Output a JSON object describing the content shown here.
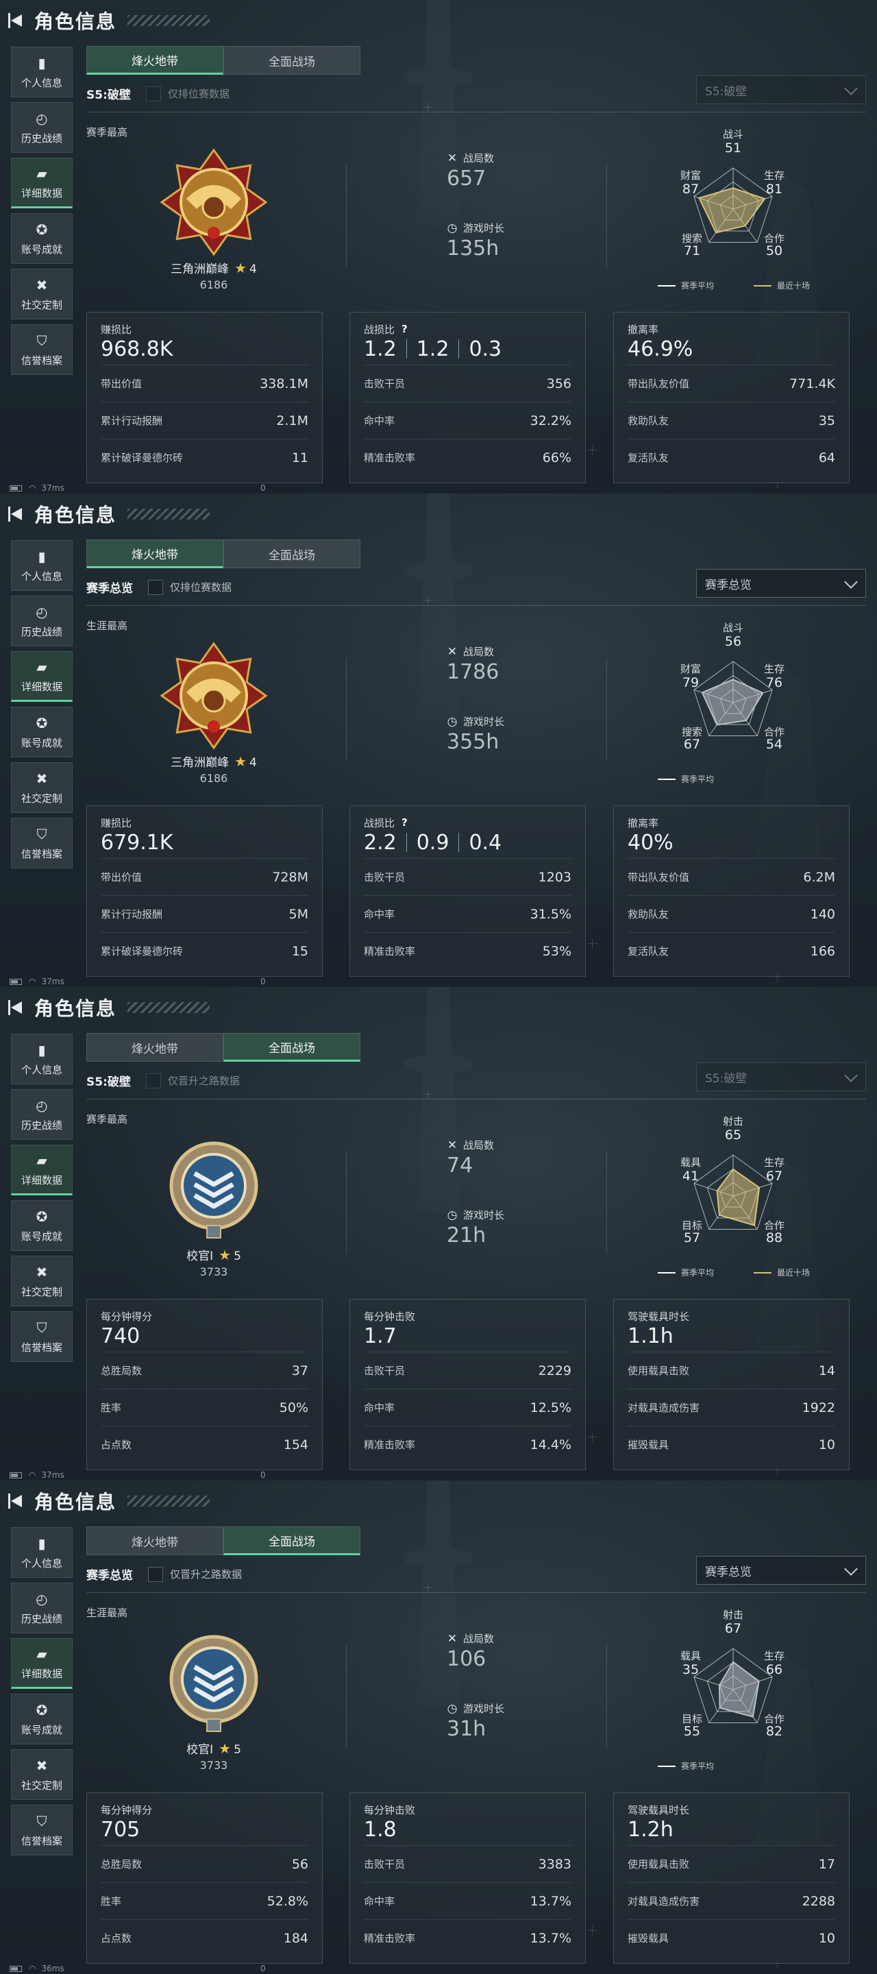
{
  "colors": {
    "accent_green": "#5fd3a0",
    "star_gold": "#e8c14d",
    "radar_gold": "#d8c27a",
    "radar_fill_gray": "#b9c0c3"
  },
  "screens": [
    {
      "header": {
        "title": "角色信息"
      },
      "sidebar": {
        "items": [
          {
            "label": "个人信息",
            "icon": "bar-chart-icon"
          },
          {
            "label": "历史战绩",
            "icon": "history-icon"
          },
          {
            "label": "详细数据",
            "icon": "folder-icon",
            "active": true
          },
          {
            "label": "账号成就",
            "icon": "achievement-icon"
          },
          {
            "label": "社交定制",
            "icon": "tools-icon"
          },
          {
            "label": "信誉档案",
            "icon": "shield-icon"
          }
        ]
      },
      "tabs": [
        {
          "label": "烽火地带",
          "active": true
        },
        {
          "label": "全面战场",
          "active": false
        }
      ],
      "filter": {
        "season": "S5:破壁",
        "checkbox_label": "仅排位赛数据",
        "dim": true
      },
      "dropdown": {
        "value": "S5:破壁",
        "dim": true
      },
      "best_label": "赛季最高",
      "rank": {
        "name": "三角洲巅峰",
        "stars": "4",
        "score": "6186",
        "badge": "gold-eagle-badge"
      },
      "matches": {
        "label": "战局数",
        "value": "657"
      },
      "playtime": {
        "label": "游戏时长",
        "value": "135h"
      },
      "radar": {
        "labels": [
          "战斗",
          "生存",
          "合作",
          "搜索",
          "财富"
        ],
        "values": [
          "51",
          "81",
          "50",
          "71",
          "87"
        ],
        "levels": [
          0.51,
          0.81,
          0.5,
          0.71,
          0.87
        ],
        "fill_color": "#d8c27a"
      },
      "legend": [
        {
          "label": "赛季平均",
          "color": "#ffffff"
        },
        {
          "label": "最近十场",
          "color": "#d8c27a"
        }
      ],
      "cards": [
        {
          "title": "赚损比",
          "main": [
            "968.8K"
          ],
          "help": false,
          "rows": [
            {
              "label": "带出价值",
              "value": "338.1M"
            },
            {
              "label": "累计行动报酬",
              "value": "2.1M"
            },
            {
              "label": "累计破译曼德尔砖",
              "value": "11"
            }
          ]
        },
        {
          "title": "战损比",
          "main": [
            "1.2",
            "1.2",
            "0.3"
          ],
          "help": true,
          "rows": [
            {
              "label": "击败干员",
              "value": "356"
            },
            {
              "label": "命中率",
              "value": "32.2%"
            },
            {
              "label": "精准击败率",
              "value": "66%"
            }
          ]
        },
        {
          "title": "撤离率",
          "main": [
            "46.9%"
          ],
          "help": false,
          "rows": [
            {
              "label": "带出队友价值",
              "value": "771.4K"
            },
            {
              "label": "救助队友",
              "value": "35"
            },
            {
              "label": "复活队友",
              "value": "64"
            }
          ]
        }
      ],
      "status": {
        "ping": "37ms",
        "zero": "0"
      }
    },
    {
      "header": {
        "title": "角色信息"
      },
      "sidebar": {
        "items": [
          {
            "label": "个人信息",
            "icon": "bar-chart-icon"
          },
          {
            "label": "历史战绩",
            "icon": "history-icon"
          },
          {
            "label": "详细数据",
            "icon": "folder-icon",
            "active": true
          },
          {
            "label": "账号成就",
            "icon": "achievement-icon"
          },
          {
            "label": "社交定制",
            "icon": "tools-icon"
          },
          {
            "label": "信誉档案",
            "icon": "shield-icon"
          }
        ]
      },
      "tabs": [
        {
          "label": "烽火地带",
          "active": true
        },
        {
          "label": "全面战场",
          "active": false
        }
      ],
      "filter": {
        "season": "赛季总览",
        "checkbox_label": "仅排位赛数据",
        "dim": false
      },
      "dropdown": {
        "value": "赛季总览",
        "dim": false
      },
      "best_label": "生涯最高",
      "rank": {
        "name": "三角洲巅峰",
        "stars": "4",
        "score": "6186",
        "badge": "gold-eagle-badge"
      },
      "matches": {
        "label": "战局数",
        "value": "1786"
      },
      "playtime": {
        "label": "游戏时长",
        "value": "355h"
      },
      "radar": {
        "labels": [
          "战斗",
          "生存",
          "合作",
          "搜索",
          "财富"
        ],
        "values": [
          "56",
          "76",
          "54",
          "67",
          "79"
        ],
        "levels": [
          0.56,
          0.76,
          0.54,
          0.67,
          0.79
        ],
        "fill_color": "#b9c0c3"
      },
      "legend": [
        {
          "label": "赛季平均",
          "color": "#ffffff"
        }
      ],
      "cards": [
        {
          "title": "赚损比",
          "main": [
            "679.1K"
          ],
          "help": false,
          "rows": [
            {
              "label": "带出价值",
              "value": "728M"
            },
            {
              "label": "累计行动报酬",
              "value": "5M"
            },
            {
              "label": "累计破译曼德尔砖",
              "value": "15"
            }
          ]
        },
        {
          "title": "战损比",
          "main": [
            "2.2",
            "0.9",
            "0.4"
          ],
          "help": true,
          "rows": [
            {
              "label": "击败干员",
              "value": "1203"
            },
            {
              "label": "命中率",
              "value": "31.5%"
            },
            {
              "label": "精准击败率",
              "value": "53%"
            }
          ]
        },
        {
          "title": "撤离率",
          "main": [
            "40%"
          ],
          "help": false,
          "rows": [
            {
              "label": "带出队友价值",
              "value": "6.2M"
            },
            {
              "label": "救助队友",
              "value": "140"
            },
            {
              "label": "复活队友",
              "value": "166"
            }
          ]
        }
      ],
      "status": {
        "ping": "37ms",
        "zero": "0"
      }
    },
    {
      "header": {
        "title": "角色信息"
      },
      "sidebar": {
        "items": [
          {
            "label": "个人信息",
            "icon": "bar-chart-icon"
          },
          {
            "label": "历史战绩",
            "icon": "history-icon"
          },
          {
            "label": "详细数据",
            "icon": "folder-icon",
            "active": true
          },
          {
            "label": "账号成就",
            "icon": "achievement-icon"
          },
          {
            "label": "社交定制",
            "icon": "tools-icon"
          },
          {
            "label": "信誉档案",
            "icon": "shield-icon"
          }
        ]
      },
      "tabs": [
        {
          "label": "烽火地带",
          "active": false
        },
        {
          "label": "全面战场",
          "active": true
        }
      ],
      "filter": {
        "season": "S5:破壁",
        "checkbox_label": "仅晋升之路数据",
        "dim": true
      },
      "dropdown": {
        "value": "S5:破壁",
        "dim": true
      },
      "best_label": "赛季最高",
      "rank": {
        "name": "校官Ⅰ",
        "stars": "5",
        "score": "3733",
        "badge": "officer-chevron-badge"
      },
      "matches": {
        "label": "战局数",
        "value": "74"
      },
      "playtime": {
        "label": "游戏时长",
        "value": "21h"
      },
      "radar": {
        "labels": [
          "射击",
          "生存",
          "合作",
          "目标",
          "载具"
        ],
        "values": [
          "65",
          "67",
          "88",
          "57",
          "41"
        ],
        "levels": [
          0.65,
          0.67,
          0.88,
          0.57,
          0.41
        ],
        "fill_color": "#d8c27a"
      },
      "legend": [
        {
          "label": "赛季平均",
          "color": "#ffffff"
        },
        {
          "label": "最近十场",
          "color": "#d8c27a"
        }
      ],
      "cards": [
        {
          "title": "每分钟得分",
          "main": [
            "740"
          ],
          "help": false,
          "rows": [
            {
              "label": "总胜局数",
              "value": "37"
            },
            {
              "label": "胜率",
              "value": "50%"
            },
            {
              "label": "占点数",
              "value": "154"
            }
          ]
        },
        {
          "title": "每分钟击败",
          "main": [
            "1.7"
          ],
          "help": false,
          "rows": [
            {
              "label": "击败干员",
              "value": "2229"
            },
            {
              "label": "命中率",
              "value": "12.5%"
            },
            {
              "label": "精准击败率",
              "value": "14.4%"
            }
          ]
        },
        {
          "title": "驾驶载具时长",
          "main": [
            "1.1h"
          ],
          "help": false,
          "rows": [
            {
              "label": "使用载具击败",
              "value": "14"
            },
            {
              "label": "对载具造成伤害",
              "value": "1922"
            },
            {
              "label": "摧毁载具",
              "value": "10"
            }
          ]
        }
      ],
      "status": {
        "ping": "37ms",
        "zero": "0"
      }
    },
    {
      "header": {
        "title": "角色信息"
      },
      "sidebar": {
        "items": [
          {
            "label": "个人信息",
            "icon": "bar-chart-icon"
          },
          {
            "label": "历史战绩",
            "icon": "history-icon"
          },
          {
            "label": "详细数据",
            "icon": "folder-icon",
            "active": true
          },
          {
            "label": "账号成就",
            "icon": "achievement-icon"
          },
          {
            "label": "社交定制",
            "icon": "tools-icon"
          },
          {
            "label": "信誉档案",
            "icon": "shield-icon"
          }
        ]
      },
      "tabs": [
        {
          "label": "烽火地带",
          "active": false
        },
        {
          "label": "全面战场",
          "active": true
        }
      ],
      "filter": {
        "season": "赛季总览",
        "checkbox_label": "仅晋升之路数据",
        "dim": false
      },
      "dropdown": {
        "value": "赛季总览",
        "dim": false
      },
      "best_label": "生涯最高",
      "rank": {
        "name": "校官Ⅰ",
        "stars": "5",
        "score": "3733",
        "badge": "officer-chevron-badge"
      },
      "matches": {
        "label": "战局数",
        "value": "106"
      },
      "playtime": {
        "label": "游戏时长",
        "value": "31h"
      },
      "radar": {
        "labels": [
          "射击",
          "生存",
          "合作",
          "目标",
          "载具"
        ],
        "values": [
          "67",
          "66",
          "82",
          "55",
          "35"
        ],
        "levels": [
          0.67,
          0.66,
          0.82,
          0.55,
          0.35
        ],
        "fill_color": "#b9c0c3"
      },
      "legend": [
        {
          "label": "赛季平均",
          "color": "#ffffff"
        }
      ],
      "cards": [
        {
          "title": "每分钟得分",
          "main": [
            "705"
          ],
          "help": false,
          "rows": [
            {
              "label": "总胜局数",
              "value": "56"
            },
            {
              "label": "胜率",
              "value": "52.8%"
            },
            {
              "label": "占点数",
              "value": "184"
            }
          ]
        },
        {
          "title": "每分钟击败",
          "main": [
            "1.8"
          ],
          "help": false,
          "rows": [
            {
              "label": "击败干员",
              "value": "3383"
            },
            {
              "label": "命中率",
              "value": "13.7%"
            },
            {
              "label": "精准击败率",
              "value": "13.7%"
            }
          ]
        },
        {
          "title": "驾驶载具时长",
          "main": [
            "1.2h"
          ],
          "help": false,
          "rows": [
            {
              "label": "使用载具击败",
              "value": "17"
            },
            {
              "label": "对载具造成伤害",
              "value": "2288"
            },
            {
              "label": "摧毁载具",
              "value": "10"
            }
          ]
        }
      ],
      "status": {
        "ping": "36ms",
        "zero": "0"
      }
    }
  ]
}
